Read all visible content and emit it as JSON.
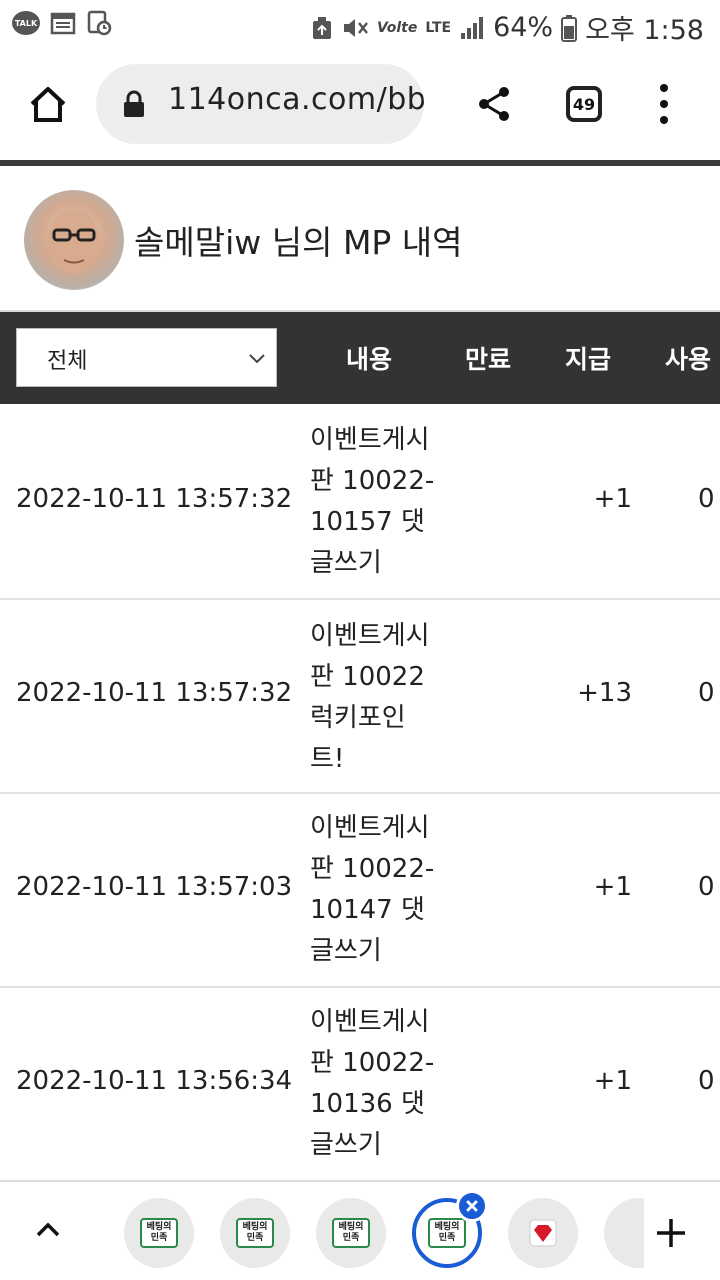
{
  "status_bar": {
    "talk_label": "TALK",
    "volte_label": "Volte",
    "lte_label": "LTE",
    "battery": "64%",
    "time": "오후 1:58"
  },
  "browser": {
    "url": "114onca.com/bb",
    "tab_count": "49"
  },
  "profile": {
    "title": "솔메말iw 님의 MP 내역"
  },
  "table": {
    "filter_value": "전체",
    "headers": {
      "content": "내용",
      "expire": "만료",
      "pay": "지급",
      "use": "사용"
    },
    "rows": [
      {
        "date": "2022-10-11 13:57:32",
        "content": "이벤트게시판 10022-10157 댓글쓰기",
        "pay": "+1",
        "use": "0"
      },
      {
        "date": "2022-10-11 13:57:32",
        "content": "이벤트게시판 10022 럭키포인트!",
        "pay": "+13",
        "use": "0"
      },
      {
        "date": "2022-10-11 13:57:03",
        "content": "이벤트게시판 10022-10147 댓글쓰기",
        "pay": "+1",
        "use": "0"
      },
      {
        "date": "2022-10-11 13:56:34",
        "content": "이벤트게시판 10022-10136 댓글쓰기",
        "pay": "+1",
        "use": "0"
      }
    ]
  },
  "bottom_tabs": {
    "logo_text": "베팅의 민족"
  },
  "colors": {
    "header_bg": "#333333",
    "active_tab_ring": "#1a5bd6"
  }
}
